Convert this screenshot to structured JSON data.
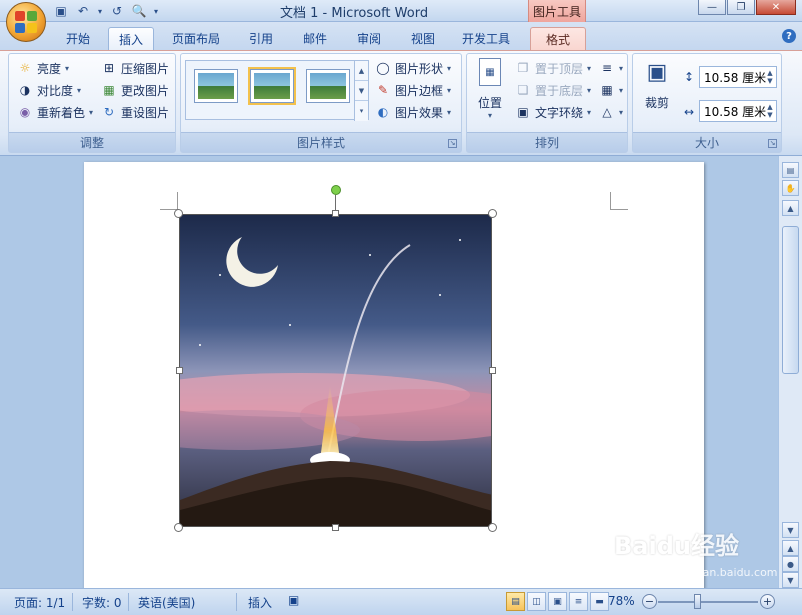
{
  "window": {
    "title": "文档 1 - Microsoft Word",
    "context_tab_group": "图片工具"
  },
  "quick_access": {
    "icons": [
      "save-icon",
      "undo-icon",
      "redo-icon",
      "print-preview-icon",
      "customize-icon"
    ]
  },
  "tabs": [
    "开始",
    "插入",
    "页面布局",
    "引用",
    "邮件",
    "审阅",
    "视图",
    "开发工具",
    "格式"
  ],
  "ribbon": {
    "adjust": {
      "label": "调整",
      "brightness": "亮度",
      "contrast": "对比度",
      "recolor": "重新着色",
      "compress": "压缩图片",
      "change": "更改图片",
      "reset": "重设图片"
    },
    "styles": {
      "label": "图片样式",
      "shape": "图片形状",
      "border": "图片边框",
      "effects": "图片效果"
    },
    "arrange": {
      "label": "排列",
      "position": "位置",
      "bring_front": "置于顶层",
      "send_back": "置于底层",
      "text_wrap": "文字环绕"
    },
    "size": {
      "label": "大小",
      "crop": "裁剪",
      "height": "10.58 厘米",
      "width": "10.58 厘米"
    }
  },
  "statusbar": {
    "page": "页面: 1/1",
    "words": "字数: 0",
    "language": "英语(美国)",
    "mode": "插入",
    "zoom": "78%"
  },
  "watermark": {
    "text": "Baidu经验",
    "sub": "jingyan.baidu.com"
  },
  "colors": {
    "ribbon_text": "#15428b",
    "format_tab": "#f9d6d0",
    "office_orange": "#f2a533"
  }
}
